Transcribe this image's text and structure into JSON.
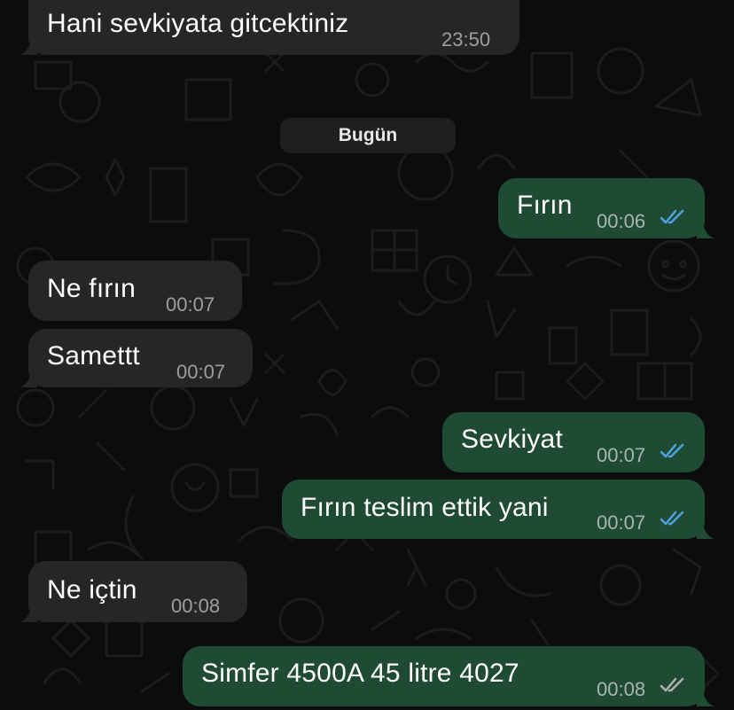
{
  "chat": {
    "date_separator": "Bugün",
    "colors": {
      "background": "#0c0c0c",
      "incoming_bubble": "#262626",
      "outgoing_bubble": "#1f4a33",
      "read_ticks": "#4fa3e0",
      "delivered_ticks": "#b0b0b0"
    },
    "messages": [
      {
        "direction": "in",
        "text": "Hani sevkiyata gitcektiniz",
        "time": "23:50"
      },
      {
        "direction": "out",
        "text": "Fırın",
        "time": "00:06",
        "status": "read"
      },
      {
        "direction": "in",
        "text": "Ne fırın",
        "time": "00:07"
      },
      {
        "direction": "in",
        "text": "Samettt",
        "time": "00:07"
      },
      {
        "direction": "out",
        "text": "Sevkiyat",
        "time": "00:07",
        "status": "read"
      },
      {
        "direction": "out",
        "text": "Fırın teslim ettik yani",
        "time": "00:07",
        "status": "read"
      },
      {
        "direction": "in",
        "text": "Ne içtin",
        "time": "00:08"
      },
      {
        "direction": "out",
        "text": "Simfer 4500A 45 litre 4027",
        "time": "00:08",
        "status": "delivered"
      }
    ]
  }
}
